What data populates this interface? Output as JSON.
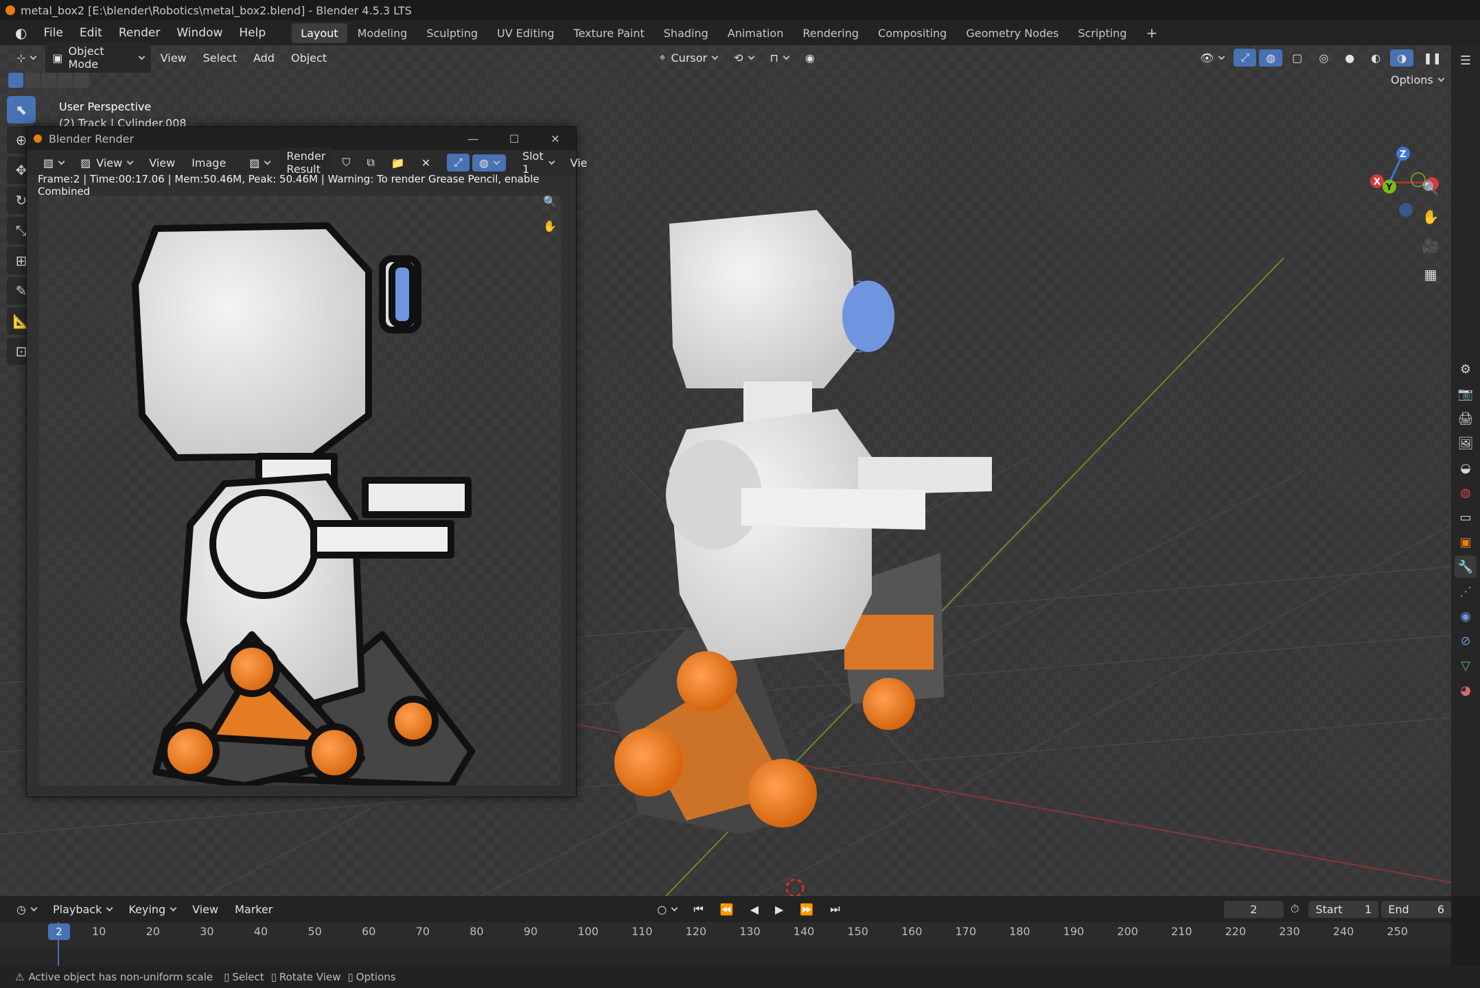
{
  "window": {
    "title": "metal_box2 [E:\\blender\\Robotics\\metal_box2.blend] - Blender 4.5.3 LTS"
  },
  "menu": [
    "File",
    "Edit",
    "Render",
    "Window",
    "Help"
  ],
  "workspaces": [
    "Layout",
    "Modeling",
    "Sculpting",
    "UV Editing",
    "Texture Paint",
    "Shading",
    "Animation",
    "Rendering",
    "Compositing",
    "Geometry Nodes",
    "Scripting"
  ],
  "active_workspace": "Layout",
  "viewport_header": {
    "mode": "Object Mode",
    "menus": [
      "View",
      "Select",
      "Add",
      "Object"
    ],
    "pivot": "Cursor",
    "options": "Options"
  },
  "viewport_overlay": {
    "perspective": "User Perspective",
    "object": "(2) Track | Cylinder.008"
  },
  "gizmo_axes": {
    "x": "X",
    "y": "Y",
    "z": "Z"
  },
  "render_window": {
    "title": "Blender Render",
    "menus": [
      "View",
      "View",
      "Image"
    ],
    "image_name": "Render Result",
    "slot": "Slot 1",
    "view_cut": "Vie",
    "info": "Frame:2 | Time:00:17.06 | Mem:50.46M, Peak: 50.46M | Warning: To render Grease Pencil, enable Combined"
  },
  "timeline": {
    "menus": [
      "Playback",
      "Keying",
      "View",
      "Marker"
    ],
    "current_frame": "2",
    "start_label": "Start",
    "start_value": "1",
    "end_label": "End",
    "end_value": "6",
    "ticks": [
      "10",
      "20",
      "30",
      "40",
      "50",
      "60",
      "70",
      "80",
      "90",
      "100",
      "110",
      "120",
      "130",
      "140",
      "150",
      "160",
      "170",
      "180",
      "190",
      "200",
      "210",
      "220",
      "230",
      "240",
      "250"
    ]
  },
  "status": {
    "warning": "Active object has non-uniform scale",
    "hints": [
      "Select",
      "Rotate View",
      "Options"
    ]
  },
  "colors": {
    "accent": "#4772b3",
    "orange": "#e87d0d",
    "eye_blue": "#6f95e0"
  }
}
